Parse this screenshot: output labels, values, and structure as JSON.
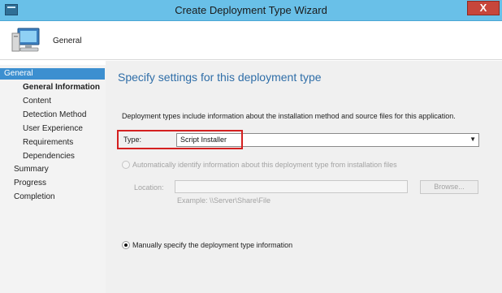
{
  "window": {
    "title": "Create Deployment Type Wizard",
    "close_label": "X"
  },
  "header": {
    "title": "General"
  },
  "nav": {
    "items": [
      {
        "label": "General",
        "active": true
      },
      {
        "label": "General Information",
        "bold": true
      },
      {
        "label": "Content"
      },
      {
        "label": "Detection Method"
      },
      {
        "label": "User Experience"
      },
      {
        "label": "Requirements"
      },
      {
        "label": "Dependencies"
      },
      {
        "label": "Summary"
      },
      {
        "label": "Progress"
      },
      {
        "label": "Completion"
      }
    ]
  },
  "main": {
    "heading": "Specify settings for this deployment type",
    "description": "Deployment types include information about the installation method and source files for this application.",
    "type_label": "Type:",
    "type_value": "Script Installer",
    "auto_option_label": "Automatically identify information about this deployment type from installation files",
    "location_label": "Location:",
    "location_value": "",
    "browse_label": "Browse...",
    "example_text": "Example: \\\\Server\\Share\\File",
    "manual_option_label": "Manually specify the deployment type information"
  },
  "colors": {
    "titlebar": "#69c0e8",
    "nav_active": "#3c8fd0",
    "heading": "#2f6ea8",
    "highlight": "#d42020"
  }
}
